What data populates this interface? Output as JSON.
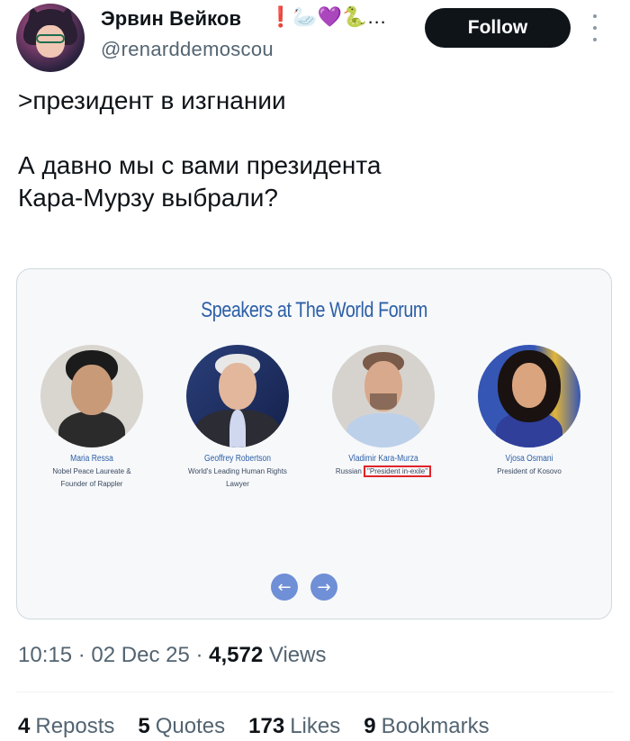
{
  "author": {
    "display_name": "Эрвин Вейков",
    "emojis": "❗🦢💜🐍…",
    "handle": "@renarddemoscou",
    "avatar_icon": "avatar-image"
  },
  "actions": {
    "follow_label": "Follow",
    "more_icon": "more-vertical-icon"
  },
  "tweet": {
    "lines": [
      ">президент в изгнании",
      "",
      "А давно мы с вами президента",
      "Кара-Мурзу выбрали?"
    ]
  },
  "media": {
    "title": "Speakers at The World Forum",
    "speakers": [
      {
        "name": "Maria Ressa",
        "role_1": "Nobel Peace Laureate &",
        "role_2": "Founder of Rappler"
      },
      {
        "name": "Geoffrey Robertson",
        "role_1": "World's Leading Human Rights",
        "role_2": "Lawyer"
      },
      {
        "name": "Vladimir Kara-Murza",
        "role_prefix": "Russian",
        "role_highlight": "\"President in-exile\""
      },
      {
        "name": "Vjosa Osmani",
        "role_1": "President of Kosovo",
        "role_2": ""
      }
    ],
    "prev_icon": "←",
    "next_icon": "→",
    "highlight_color": "#e0242a",
    "title_color": "#2c5fa6"
  },
  "meta": {
    "time": "10:15",
    "separator": "·",
    "date": "02 Dec 25",
    "views_count": "4,572",
    "views_label": "Views"
  },
  "stats": {
    "reposts_count": "4",
    "reposts_label": "Reposts",
    "quotes_count": "5",
    "quotes_label": "Quotes",
    "likes_count": "173",
    "likes_label": "Likes",
    "bookmarks_count": "9",
    "bookmarks_label": "Bookmarks"
  }
}
